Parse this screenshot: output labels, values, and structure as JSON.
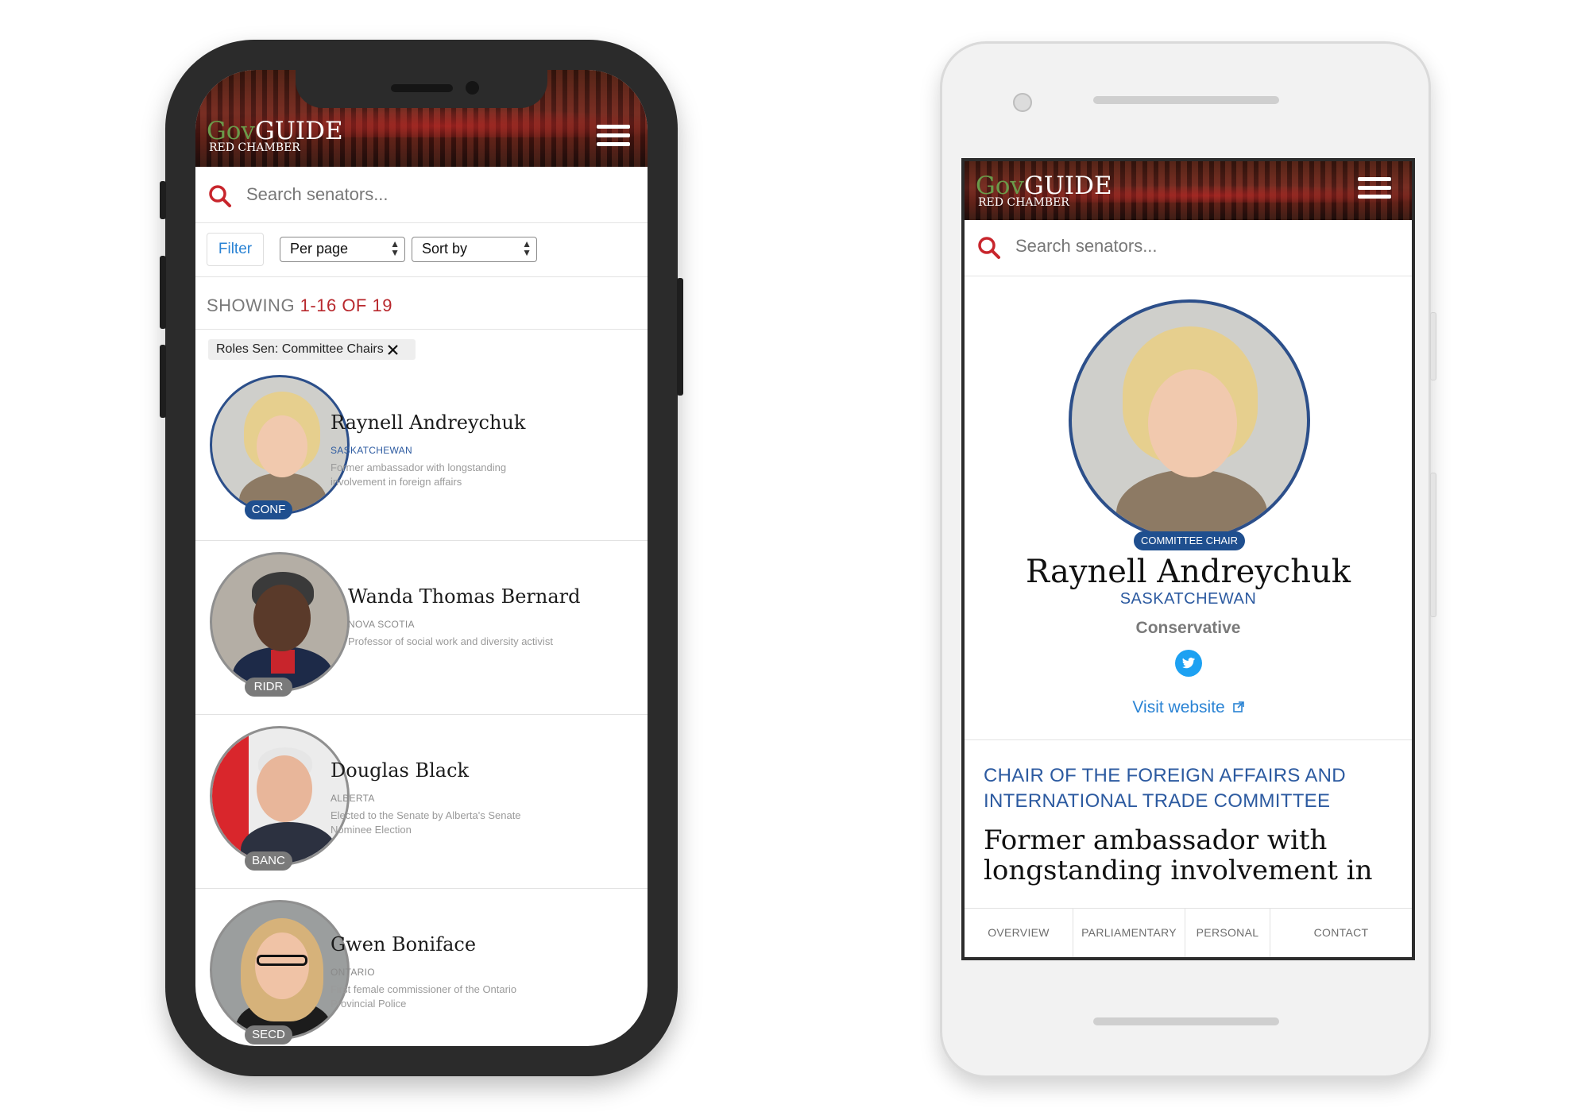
{
  "app": {
    "logo_gov": "Gov",
    "logo_guide": "GUIDE",
    "logo_sub": "RED CHAMBER"
  },
  "search": {
    "placeholder": "Search senators..."
  },
  "list_view": {
    "filter_label": "Filter",
    "per_page_label": "Per page",
    "sort_by_label": "Sort by",
    "showing_prefix": "SHOWING ",
    "showing_range": "1-16 OF 19",
    "active_filter_chip": "Roles Sen: Committee Chairs",
    "senators": [
      {
        "name": "Raynell Andreychuk",
        "province": "SASKATCHEWAN",
        "description": "Former ambassador with longstanding involvement in foreign affairs",
        "badge": "CONF",
        "badge_color": "#1f4f8f"
      },
      {
        "name": "Wanda Thomas Bernard",
        "province": "NOVA SCOTIA",
        "description": "Professor of social work and diversity activist",
        "badge": "RIDR",
        "badge_color": "#7a7a7a"
      },
      {
        "name": "Douglas Black",
        "province": "ALBERTA",
        "description": "Elected to the Senate by Alberta's Senate Nominee Election",
        "badge": "BANC",
        "badge_color": "#7a7a7a"
      },
      {
        "name": "Gwen Boniface",
        "province": "ONTARIO",
        "description": "First female commissioner of the Ontario Provincial Police",
        "badge": "SECD",
        "badge_color": "#7a7a7a"
      }
    ]
  },
  "profile_view": {
    "badge": "COMMITTEE CHAIR",
    "name": "Raynell Andreychuk",
    "province": "SASKATCHEWAN",
    "party": "Conservative",
    "visit_website": "Visit website",
    "role_heading": "CHAIR OF THE FOREIGN AFFAIRS AND INTERNATIONAL TRADE COMMITTEE",
    "summary": "Former ambassador with longstanding involvement in",
    "tabs": [
      "OVERVIEW",
      "PARLIAMENTARY",
      "PERSONAL",
      "CONTACT"
    ]
  },
  "colors": {
    "accent_red": "#b8282d",
    "accent_blue": "#1f4f8f",
    "link_blue": "#2a83d4",
    "twitter": "#1da1f2"
  },
  "icons": [
    "search-icon",
    "menu-icon",
    "close-icon",
    "twitter-icon",
    "external-link-icon",
    "chevron-updown-icon"
  ]
}
